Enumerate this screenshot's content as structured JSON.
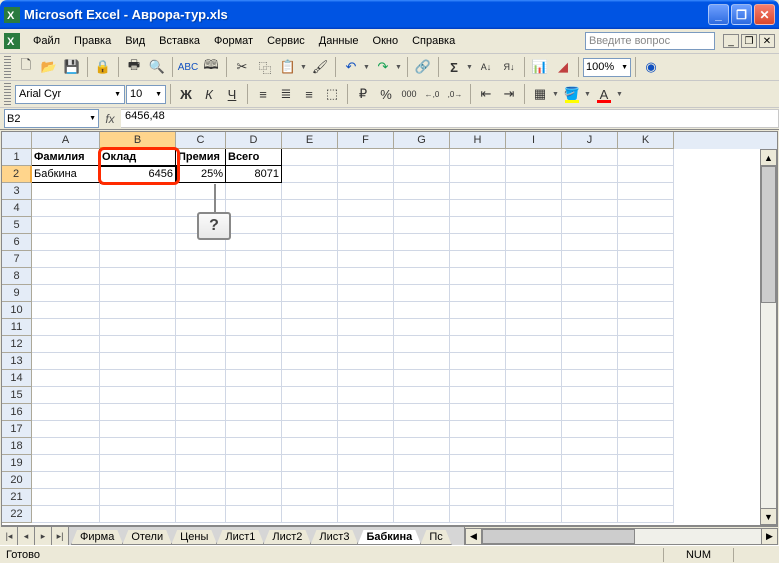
{
  "titlebar": {
    "app": "Microsoft Excel",
    "doc": "Аврора-тур.xls"
  },
  "menu": {
    "file": "Файл",
    "edit": "Правка",
    "view": "Вид",
    "insert": "Вставка",
    "format": "Формат",
    "tools": "Сервис",
    "data": "Данные",
    "window": "Окно",
    "help": "Справка"
  },
  "help_placeholder": "Введите вопрос",
  "toolbar": {
    "zoom": "100%"
  },
  "format": {
    "font": "Arial Cyr",
    "size": "10"
  },
  "namebox": "B2",
  "formula": "6456,48",
  "columns": [
    "A",
    "B",
    "C",
    "D",
    "E",
    "F",
    "G",
    "H",
    "I",
    "J",
    "K"
  ],
  "rows": [
    1,
    2,
    3,
    4,
    5,
    6,
    7,
    8,
    9,
    10,
    11,
    12,
    13,
    14,
    15,
    16,
    17,
    18,
    19,
    20,
    21,
    22
  ],
  "headers": {
    "A": "Фамилия",
    "B": "Оклад",
    "C": "Премия",
    "D": "Всего"
  },
  "datarow": {
    "A": "Бабкина",
    "B": "6456",
    "C": "25%",
    "D": "8071"
  },
  "callout": "?",
  "selected": {
    "col": "B",
    "row": 2
  },
  "tabs": {
    "nav": [
      "|◂",
      "◂",
      "▸",
      "▸|"
    ],
    "sheets": [
      "Фирма",
      "Отели",
      "Цены",
      "Лист1",
      "Лист2",
      "Лист3",
      "Бабкина",
      "Пс"
    ],
    "active": "Бабкина"
  },
  "status": {
    "ready": "Готово",
    "num": "NUM"
  }
}
